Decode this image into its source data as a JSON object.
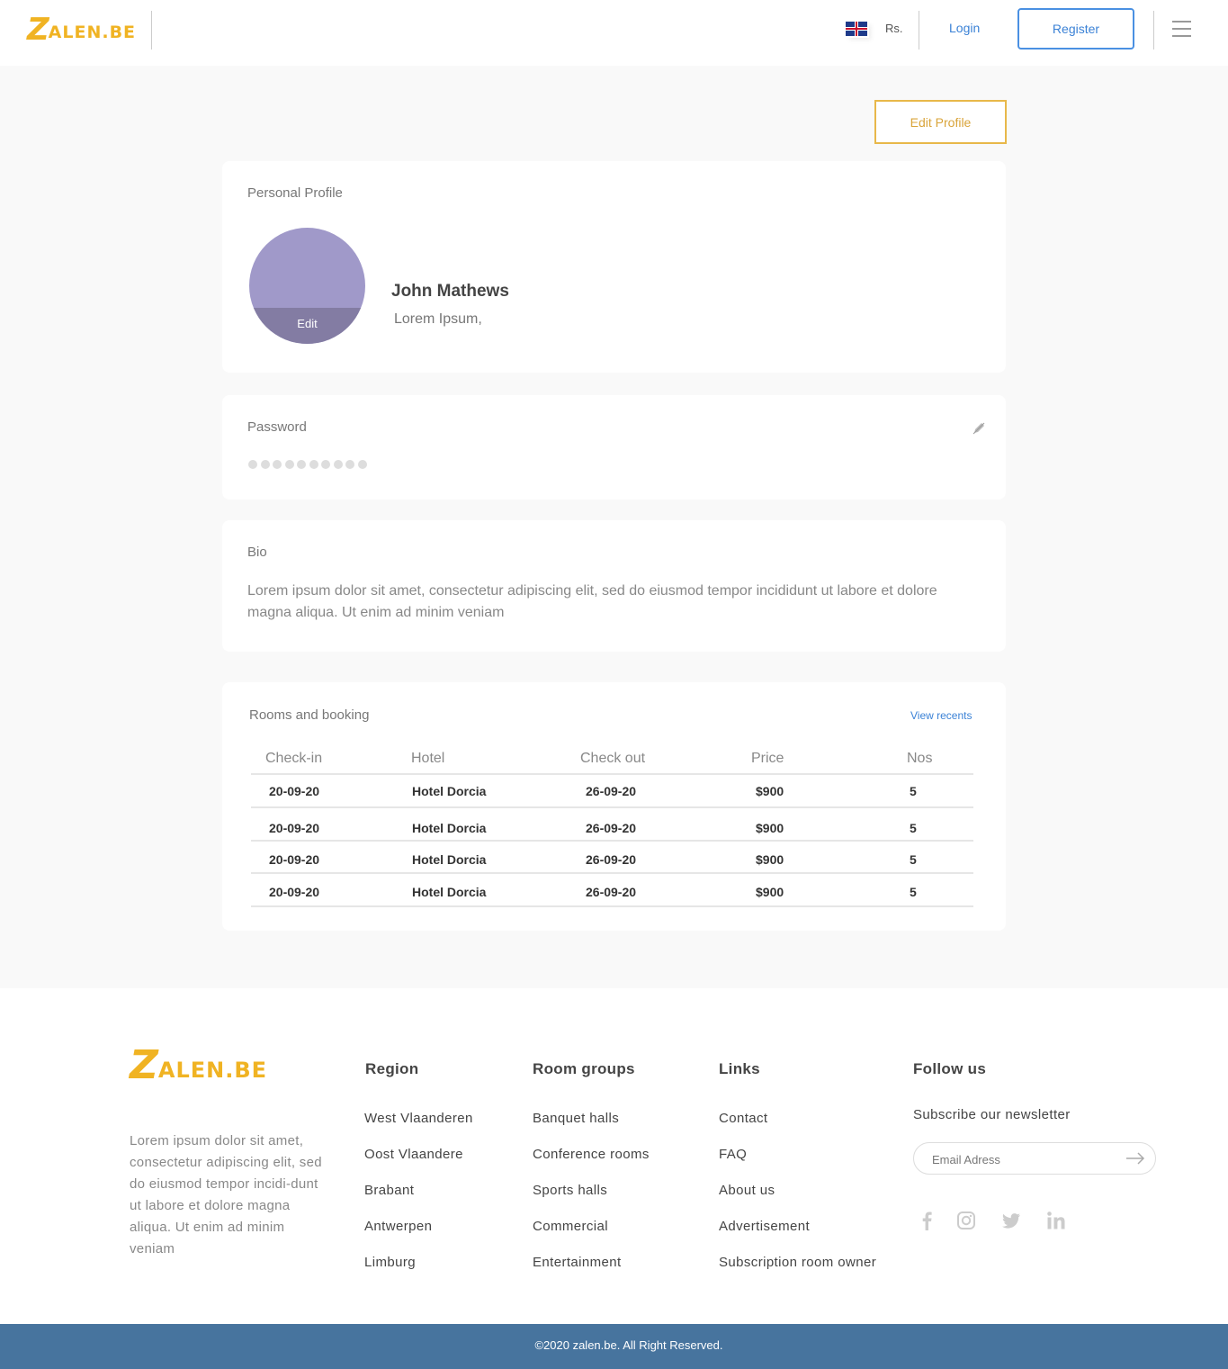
{
  "header": {
    "logo_initial": "Z",
    "logo_rest": "ALEN.BE",
    "currency": "Rs.",
    "login_label": "Login",
    "register_label": "Register"
  },
  "edit_profile_label": "Edit Profile",
  "profile": {
    "title": "Personal Profile",
    "avatar_edit_label": "Edit",
    "name": "John Mathews",
    "subtitle": "Lorem Ipsum,"
  },
  "password": {
    "title": "Password"
  },
  "bio": {
    "title": "Bio",
    "text": "Lorem ipsum dolor sit amet, consectetur adipiscing elit, sed do eiusmod tempor incididunt ut labore et dolore magna aliqua. Ut enim ad minim veniam"
  },
  "bookings": {
    "title": "Rooms and booking",
    "view_recents": "View recents",
    "columns": [
      "Check-in",
      "Hotel",
      "Check out",
      "Price",
      "Nos"
    ],
    "rows": [
      [
        "20-09-20",
        "Hotel Dorcia",
        "26-09-20",
        "$900",
        "5"
      ],
      [
        "20-09-20",
        "Hotel Dorcia",
        "26-09-20",
        "$900",
        "5"
      ],
      [
        "20-09-20",
        "Hotel Dorcia",
        "26-09-20",
        "$900",
        "5"
      ],
      [
        "20-09-20",
        "Hotel Dorcia",
        "26-09-20",
        "$900",
        "5"
      ]
    ]
  },
  "footer": {
    "logo_initial": "Z",
    "logo_rest": "ALEN.BE",
    "description": "Lorem ipsum dolor sit amet, consectetur adipiscing elit, sed do eiusmod tempor incidi-dunt ut labore et dolore magna aliqua. Ut enim ad minim veniam",
    "region": {
      "title": "Region",
      "items": [
        "West Vlaanderen",
        "Oost Vlaandere",
        "Brabant",
        "Antwerpen",
        "Limburg"
      ]
    },
    "room_groups": {
      "title": "Room groups",
      "items": [
        "Banquet halls",
        "Conference rooms",
        "Sports halls",
        "Commercial",
        "Entertainment"
      ]
    },
    "links": {
      "title": "Links",
      "items": [
        "Contact",
        "FAQ",
        "About us",
        "Advertisement",
        "Subscription room owner"
      ]
    },
    "follow": {
      "title": "Follow us",
      "subscribe": "Subscribe our newsletter",
      "email_placeholder": "Email Adress",
      "socials": [
        "facebook-icon",
        "instagram-icon",
        "twitter-icon",
        "linkedin-icon"
      ]
    },
    "copyright": "©2020 zalen.be. All Right Reserved."
  }
}
